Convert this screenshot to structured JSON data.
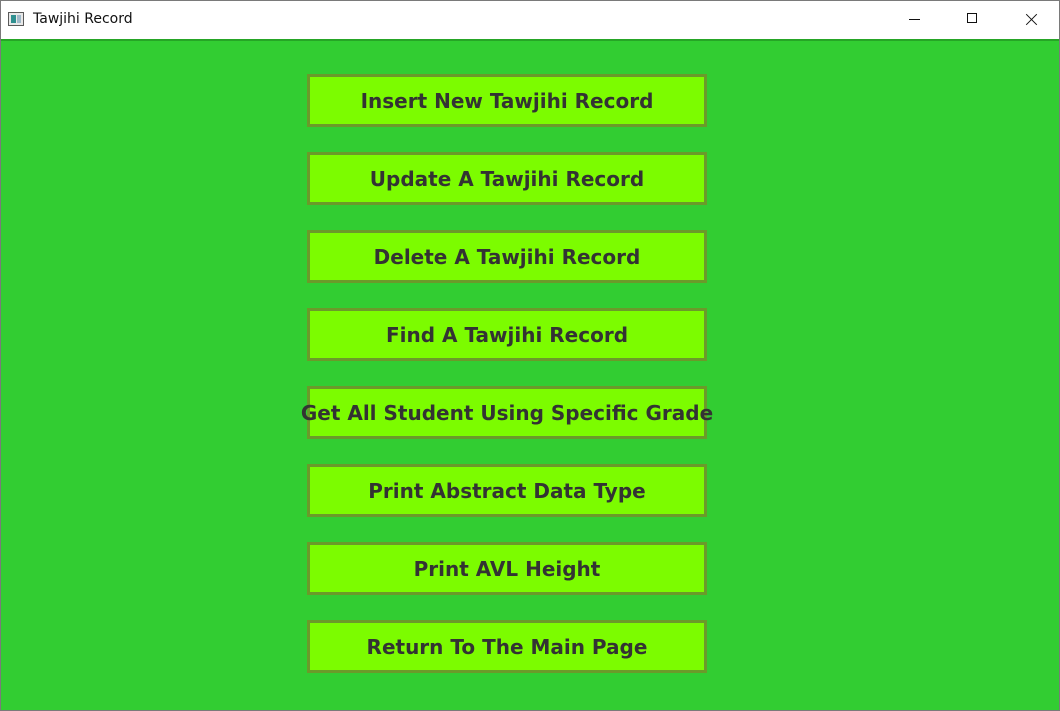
{
  "window": {
    "title": "Tawjihi Record",
    "icon": "app-window-icon",
    "controls": [
      "minimize",
      "maximize",
      "close"
    ]
  },
  "colors": {
    "background": "#32cd32",
    "button_fill": "#7cfc00",
    "button_border": "#6b9a2a",
    "button_text": "#333333"
  },
  "menu": {
    "buttons": [
      {
        "label": "Insert New Tawjihi Record"
      },
      {
        "label": "Update A Tawjihi Record"
      },
      {
        "label": "Delete A Tawjihi Record"
      },
      {
        "label": "Find A Tawjihi Record"
      },
      {
        "label": "Get All Student Using Specific Grade"
      },
      {
        "label": "Print Abstract Data Type"
      },
      {
        "label": "Print AVL Height"
      },
      {
        "label": "Return To The Main Page"
      }
    ]
  }
}
